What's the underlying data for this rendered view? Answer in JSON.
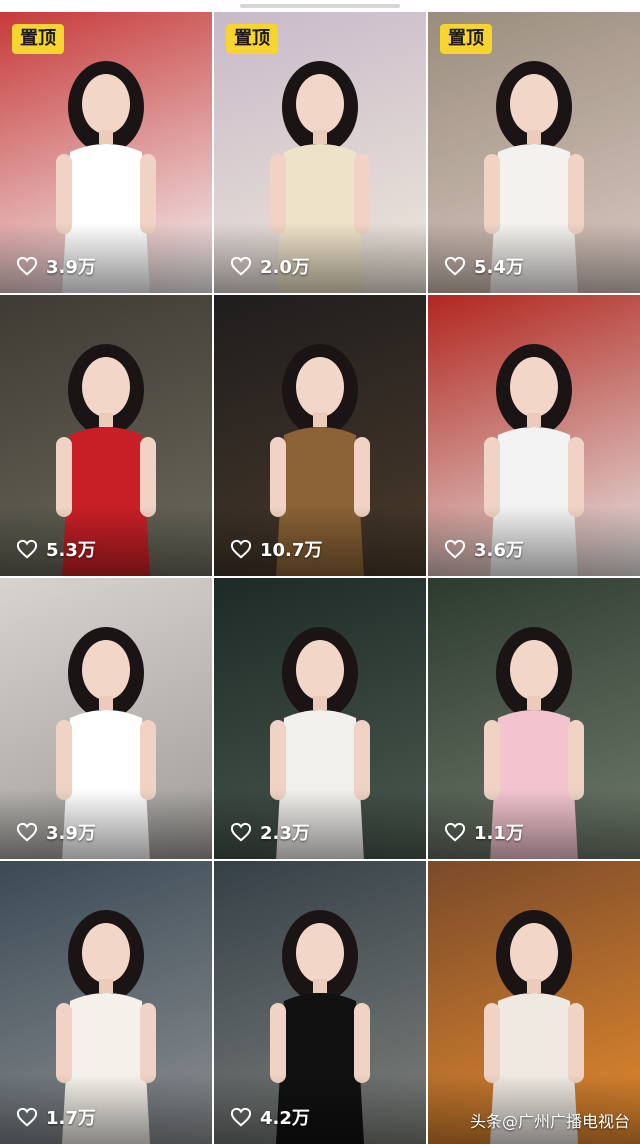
{
  "pinned_label": "置顶",
  "watermark": "头条@广州广播电视台",
  "posts": [
    {
      "likes": "3.9万",
      "pinned": true,
      "bg": "#c73a3a",
      "bg2": "#f4f4f4",
      "outfit": "#ffffff"
    },
    {
      "likes": "2.0万",
      "pinned": true,
      "bg": "#c8b9c9",
      "bg2": "#efe7da",
      "outfit": "#eee2c9"
    },
    {
      "likes": "5.4万",
      "pinned": true,
      "bg": "#9a8d7d",
      "bg2": "#d8c7c0",
      "outfit": "#f4f2ee"
    },
    {
      "likes": "5.3万",
      "pinned": false,
      "bg": "#3d3b33",
      "bg2": "#6c6a5c",
      "outfit": "#c81f26"
    },
    {
      "likes": "10.7万",
      "pinned": false,
      "bg": "#1f1d1e",
      "bg2": "#4a3a2a",
      "outfit": "#8a6236"
    },
    {
      "likes": "3.6万",
      "pinned": false,
      "bg": "#b1271f",
      "bg2": "#e6e4e2",
      "outfit": "#f3f3f3"
    },
    {
      "likes": "3.9万",
      "pinned": false,
      "bg": "#d7d3d0",
      "bg2": "#9f9c99",
      "outfit": "#ffffff"
    },
    {
      "likes": "2.3万",
      "pinned": false,
      "bg": "#1d2a27",
      "bg2": "#4b5a4f",
      "outfit": "#f2f0ec"
    },
    {
      "likes": "1.1万",
      "pinned": false,
      "bg": "#2d3b2f",
      "bg2": "#6f7a6b",
      "outfit": "#f3c4cf"
    },
    {
      "likes": "1.7万",
      "pinned": false,
      "bg": "#3b4a55",
      "bg2": "#8c8f92",
      "outfit": "#f5f1ea"
    },
    {
      "likes": "4.2万",
      "pinned": false,
      "bg": "#354047",
      "bg2": "#7d7f7b",
      "outfit": "#111111"
    },
    {
      "likes": "",
      "pinned": false,
      "bg": "#7a4a2a",
      "bg2": "#e58b2e",
      "outfit": "#efe9e2"
    }
  ]
}
